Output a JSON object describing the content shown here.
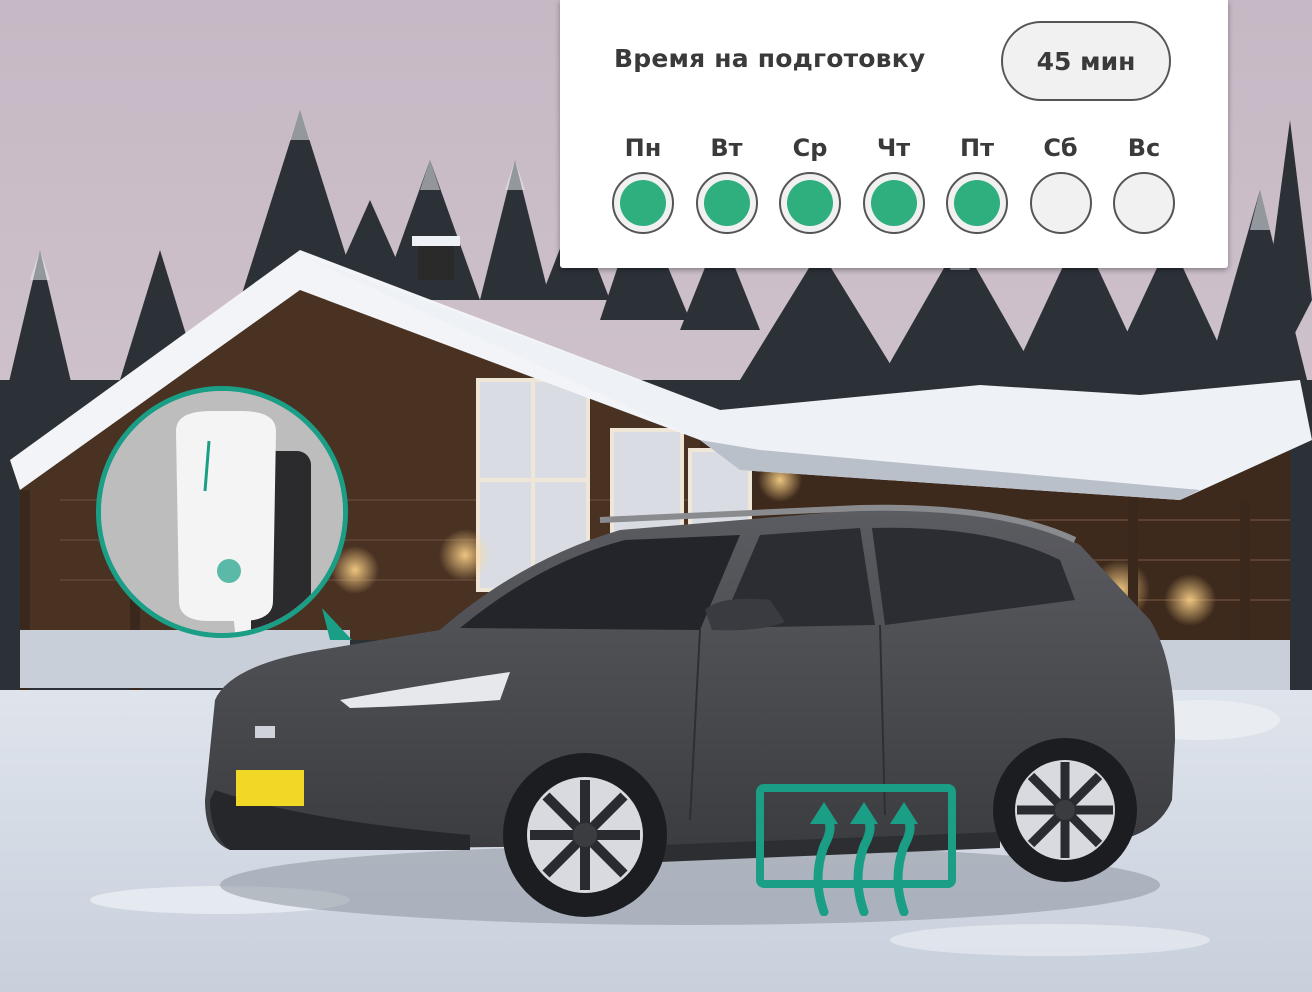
{
  "preparation": {
    "label": "Время на подготовку",
    "duration": "45 мин"
  },
  "schedule": {
    "days": [
      {
        "label": "Пн",
        "enabled": true
      },
      {
        "label": "Вт",
        "enabled": true
      },
      {
        "label": "Ср",
        "enabled": true
      },
      {
        "label": "Чт",
        "enabled": true
      },
      {
        "label": "Пт",
        "enabled": true
      },
      {
        "label": "Сб",
        "enabled": false
      },
      {
        "label": "Вс",
        "enabled": false
      }
    ]
  },
  "colors": {
    "accent": "#2fae7e",
    "frame": "#1a9f86",
    "car": "#4a4b4f",
    "plate": "#f2d727"
  },
  "icons": [
    "wallbox-charger-icon",
    "battery-heating-icon"
  ]
}
